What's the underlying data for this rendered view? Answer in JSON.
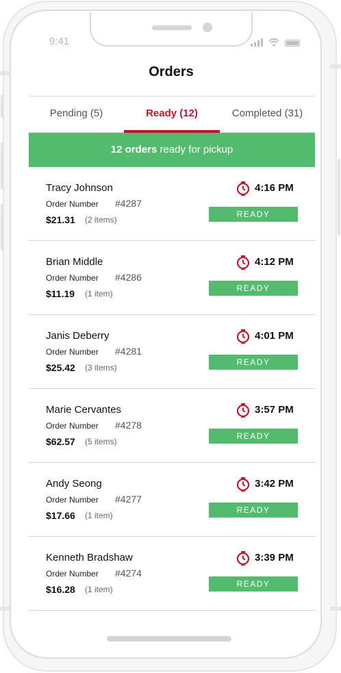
{
  "status_bar": {
    "time": "9:41"
  },
  "header": {
    "title": "Orders"
  },
  "tabs": [
    {
      "label": "Pending (5)",
      "active": false
    },
    {
      "label": "Ready (12)",
      "active": true
    },
    {
      "label": "Completed (31)",
      "active": false
    }
  ],
  "banner": {
    "count_text": "12 orders",
    "rest_text": " ready for pickup"
  },
  "orders": [
    {
      "name": "Tracy Johnson",
      "number_label": "Order Number",
      "number": "#4287",
      "total": "$21.31",
      "items": "(2 items)",
      "time": "4:16 PM",
      "status": "READY"
    },
    {
      "name": "Brian Middle",
      "number_label": "Order Number",
      "number": "#4286",
      "total": "$11.19",
      "items": "(1 item)",
      "time": "4:12 PM",
      "status": "READY"
    },
    {
      "name": "Janis Deberry",
      "number_label": "Order Number",
      "number": "#4281",
      "total": "$25.42",
      "items": "(3 items)",
      "time": "4:01 PM",
      "status": "READY"
    },
    {
      "name": "Marie Cervantes",
      "number_label": "Order Number",
      "number": "#4278",
      "total": "$62.57",
      "items": "(5 items)",
      "time": "3:57 PM",
      "status": "READY"
    },
    {
      "name": "Andy Seong",
      "number_label": "Order Number",
      "number": "#4277",
      "total": "$17.66",
      "items": "(1 item)",
      "time": "3:42 PM",
      "status": "READY"
    },
    {
      "name": "Kenneth Bradshaw",
      "number_label": "Order Number",
      "number": "#4274",
      "total": "$16.28",
      "items": "(1 item)",
      "time": "3:39 PM",
      "status": "READY"
    }
  ],
  "icons": {
    "time_icon": "clock-icon"
  },
  "colors": {
    "accent": "#c1142b",
    "ready_green": "#52bb6d"
  }
}
